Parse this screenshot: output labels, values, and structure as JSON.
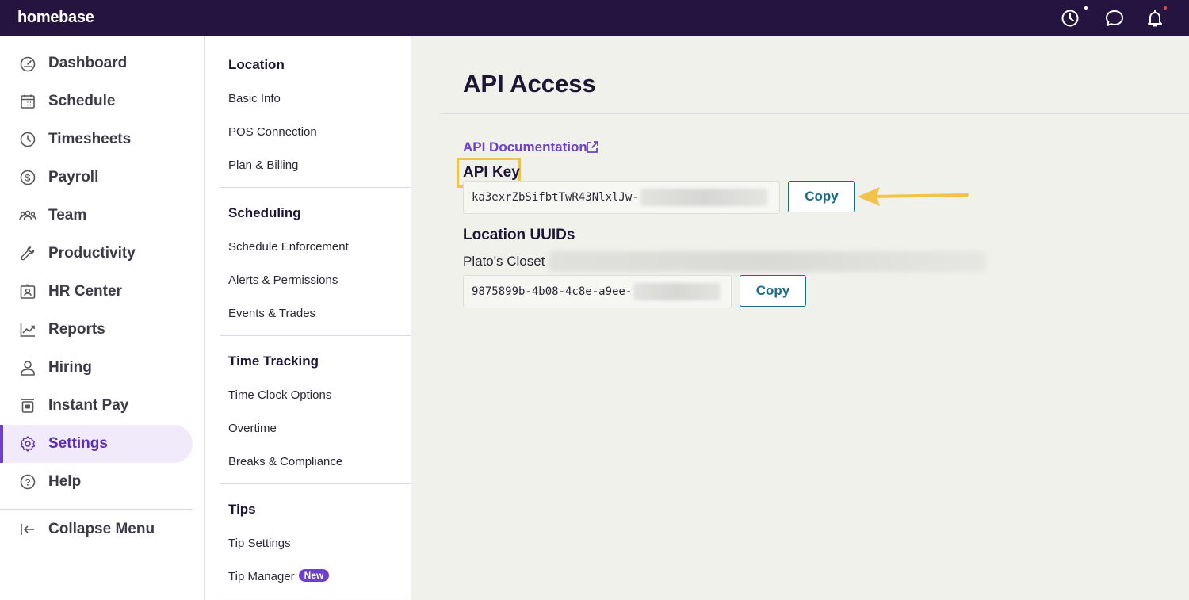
{
  "brand": "homebase",
  "topbar_icons": [
    "clock-icon",
    "chat-icon",
    "bell-icon"
  ],
  "colors": {
    "topbar": "#251440",
    "accent": "#6d3fcc",
    "copy_button": "#1b6a8a",
    "highlight": "#f3c24a",
    "notification_dot": "#e5484d"
  },
  "sidebar": {
    "items": [
      {
        "label": "Dashboard",
        "icon": "dashboard-icon"
      },
      {
        "label": "Schedule",
        "icon": "calendar-icon"
      },
      {
        "label": "Timesheets",
        "icon": "clock-icon"
      },
      {
        "label": "Payroll",
        "icon": "dollar-icon"
      },
      {
        "label": "Team",
        "icon": "team-icon"
      },
      {
        "label": "Productivity",
        "icon": "wrench-icon"
      },
      {
        "label": "HR Center",
        "icon": "id-badge-icon"
      },
      {
        "label": "Reports",
        "icon": "chart-icon"
      },
      {
        "label": "Hiring",
        "icon": "person-icon"
      },
      {
        "label": "Instant Pay",
        "icon": "wallet-icon"
      },
      {
        "label": "Settings",
        "icon": "gear-icon",
        "active": true
      },
      {
        "label": "Help",
        "icon": "help-icon"
      }
    ],
    "collapse_label": "Collapse Menu"
  },
  "submenu": {
    "sections": [
      {
        "title": "Location",
        "items": [
          "Basic Info",
          "POS Connection",
          "Plan & Billing"
        ]
      },
      {
        "title": "Scheduling",
        "items": [
          "Schedule Enforcement",
          "Alerts & Permissions",
          "Events & Trades"
        ]
      },
      {
        "title": "Time Tracking",
        "items": [
          "Time Clock Options",
          "Overtime",
          "Breaks & Compliance"
        ]
      },
      {
        "title": "Tips",
        "items": [
          "Tip Settings",
          "Tip Manager"
        ]
      }
    ],
    "new_badge": "New"
  },
  "main": {
    "title": "API Access",
    "doc_link": "API Documentation",
    "api_key_label": "API Key",
    "api_key_value": "ka3exrZbSifbtTwR43NlxlJw-",
    "copy_label": "Copy",
    "location_uuids_label": "Location UUIDs",
    "location_name": "Plato's Closet",
    "location_uuid_value": "9875899b-4b08-4c8e-a9ee-"
  }
}
